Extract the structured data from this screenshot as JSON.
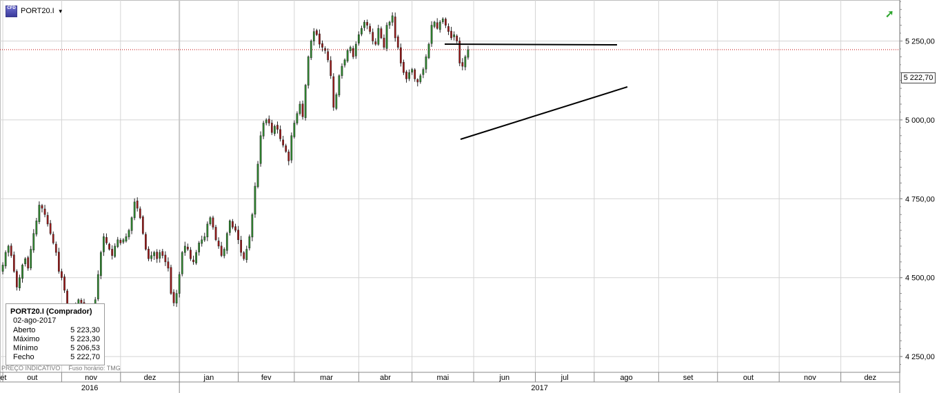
{
  "header": {
    "symbol": "PORT20.I",
    "logo_text": "CFD",
    "caret": "▼",
    "trend_icon": "trend-up-icon"
  },
  "infobox": {
    "title": "PORT20.I (Comprador)",
    "date": "02-ago-2017",
    "rows": [
      {
        "label": "Aberto",
        "value": "5 223,30"
      },
      {
        "label": "Máximo",
        "value": "5 223,30"
      },
      {
        "label": "Mínimo",
        "value": "5 206,53"
      },
      {
        "label": "Fecho",
        "value": "5 222,70"
      }
    ]
  },
  "footer": {
    "price_type": "PREÇO INDICATIVO",
    "timezone": "Fuso horário: TMG"
  },
  "price_tag": "5 222,70",
  "colors": {
    "up": "#2e8b2e",
    "down": "#a01818",
    "grid": "#d4d4d4",
    "last_line": "#c00000"
  },
  "chart_data": {
    "type": "candlestick",
    "ylim": [
      4200,
      5380
    ],
    "y_ticks": [
      {
        "value": 4250,
        "label": "4 250,00"
      },
      {
        "value": 4500,
        "label": "4 500,00"
      },
      {
        "value": 4750,
        "label": "4 750,00"
      },
      {
        "value": 5000,
        "label": "5 000,00"
      },
      {
        "value": 5250,
        "label": "5 250,00"
      }
    ],
    "last_price": 5222.7,
    "months": [
      {
        "label": "set",
        "start": 0
      },
      {
        "label": "out",
        "start": 1
      },
      {
        "label": "nov",
        "start": 22
      },
      {
        "label": "dez",
        "start": 43
      },
      {
        "label": "jan",
        "start": 64
      },
      {
        "label": "fev",
        "start": 85
      },
      {
        "label": "mar",
        "start": 105
      },
      {
        "label": "abr",
        "start": 128
      },
      {
        "label": "mai",
        "start": 147
      },
      {
        "label": "jun",
        "start": 169
      },
      {
        "label": "jul",
        "start": 191
      },
      {
        "label": "ago",
        "start": 212
      },
      {
        "label": "set",
        "start": 235
      },
      {
        "label": "out",
        "start": 256
      },
      {
        "label": "nov",
        "start": 278
      },
      {
        "label": "dez",
        "start": 300
      },
      {
        "label": "",
        "start": 321
      }
    ],
    "years": [
      {
        "label": "2016",
        "start": 0,
        "end": 64
      },
      {
        "label": "2017",
        "start": 64,
        "end": 321
      }
    ],
    "closes": [
      4540,
      4580,
      4600,
      4570,
      4520,
      4470,
      4500,
      4540,
      4560,
      4530,
      4590,
      4640,
      4680,
      4730,
      4720,
      4700,
      4670,
      4640,
      4610,
      4580,
      4520,
      4500,
      4460,
      4380,
      4360,
      4400,
      4410,
      4430,
      4420,
      4410,
      4390,
      4400,
      4380,
      4430,
      4510,
      4580,
      4630,
      4610,
      4590,
      4570,
      4600,
      4620,
      4610,
      4620,
      4630,
      4650,
      4690,
      4740,
      4720,
      4690,
      4640,
      4590,
      4560,
      4570,
      4580,
      4560,
      4580,
      4570,
      4550,
      4530,
      4450,
      4420,
      4450,
      4510,
      4580,
      4600,
      4590,
      4560,
      4550,
      4580,
      4610,
      4620,
      4630,
      4670,
      4690,
      4660,
      4620,
      4600,
      4570,
      4590,
      4640,
      4680,
      4660,
      4650,
      4620,
      4580,
      4560,
      4590,
      4630,
      4700,
      4790,
      4860,
      4950,
      4990,
      5000,
      4990,
      4960,
      4980,
      4970,
      4940,
      4920,
      4900,
      4870,
      4950,
      4990,
      5020,
      5050,
      5010,
      5110,
      5200,
      5250,
      5280,
      5270,
      5240,
      5230,
      5220,
      5190,
      5140,
      5040,
      5080,
      5140,
      5170,
      5190,
      5220,
      5230,
      5200,
      5240,
      5270,
      5290,
      5310,
      5300,
      5280,
      5250,
      5240,
      5290,
      5260,
      5230,
      5300,
      5310,
      5330,
      5260,
      5230,
      5180,
      5150,
      5130,
      5150,
      5160,
      5130,
      5120,
      5140,
      5160,
      5200,
      5240,
      5300,
      5310,
      5290,
      5310,
      5320,
      5300,
      5280,
      5260,
      5270,
      5250,
      5180,
      5170,
      5200,
      5222.7
    ],
    "start_index": 0
  }
}
